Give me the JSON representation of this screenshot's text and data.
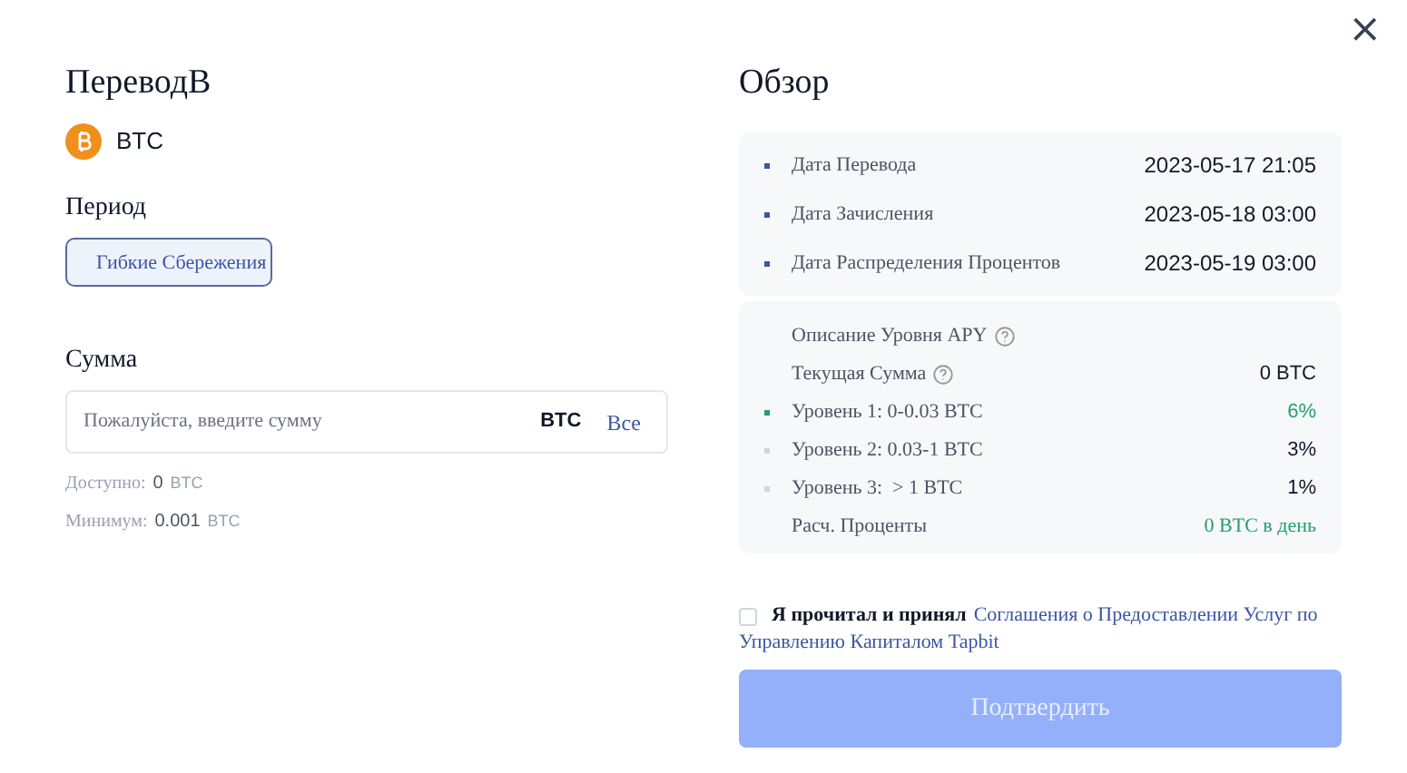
{
  "close_label": "×",
  "left": {
    "title": "ПереводВ",
    "coin": "BTC",
    "period_label": "Период",
    "period_options": [
      {
        "label": "Гибкие Сбережения",
        "selected": true
      }
    ],
    "amount_label": "Сумма",
    "amount_field": {
      "placeholder": "Пожалуйста, введите сумму",
      "unit": "BTC",
      "all_button": "Все"
    },
    "available": {
      "label": "Доступно:",
      "value": "0",
      "unit": "BTC"
    },
    "minimum": {
      "label": "Минимум:",
      "value": "0.001",
      "unit": "BTC"
    }
  },
  "right": {
    "title": "Обзор",
    "dates": [
      {
        "label": "Дата Перевода",
        "value": "2023-05-17 21:05"
      },
      {
        "label": "Дата Зачисления",
        "value": "2023-05-18 03:00"
      },
      {
        "label": "Дата Распределения Процентов",
        "value": "2023-05-19 03:00"
      }
    ],
    "apy_title": "Описание Уровня APY",
    "current_label": "Текущая Сумма",
    "current_value": "0 BTC",
    "tiers": [
      {
        "label": "Уровень 1: 0-0.03 BTC",
        "rate": "6%",
        "active": true
      },
      {
        "label": "Уровень 2: 0.03-1 BTC",
        "rate": "3%",
        "active": false
      },
      {
        "label": "Уровень 3:  > 1 BTC",
        "rate": "1%",
        "active": false
      }
    ],
    "estimate_label": "Расч. Проценты",
    "estimate_value": "0 BTC в день",
    "agreement": {
      "checked": false,
      "prefix": "Я прочитал и принял",
      "link_lines": [
        "Соглашения о Предоставлении Услуг по",
        "Управлению Капиталом Tapbit"
      ]
    },
    "confirm": {
      "label": "Подтвердить",
      "disabled": true
    }
  }
}
